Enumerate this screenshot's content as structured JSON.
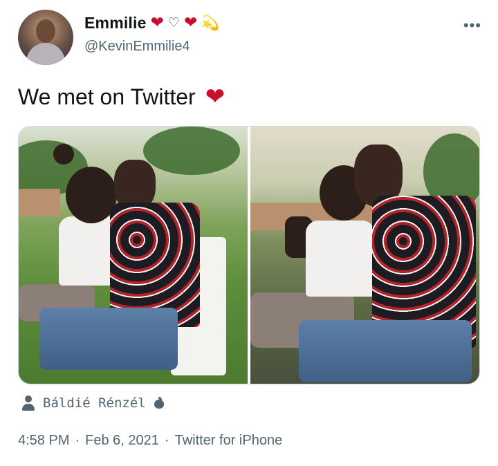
{
  "author": {
    "display_name": "Emmilie",
    "handle": "@KevinEmmilie4",
    "name_emojis": [
      "❤",
      "♡",
      "❤",
      "💫"
    ]
  },
  "tweet": {
    "text": "We met on Twitter",
    "emoji": "❤"
  },
  "media": {
    "photos": [
      {
        "name": "photo-left"
      },
      {
        "name": "photo-right"
      }
    ]
  },
  "attribution": {
    "name": "Báldié Rénzél",
    "icon": "apple-icon"
  },
  "meta": {
    "time": "4:58 PM",
    "separator": "·",
    "date": "Feb 6, 2021",
    "source": "Twitter for iPhone"
  },
  "colors": {
    "heart": "#c8102e",
    "secondary_text": "#536471",
    "primary_text": "#0f1419"
  }
}
